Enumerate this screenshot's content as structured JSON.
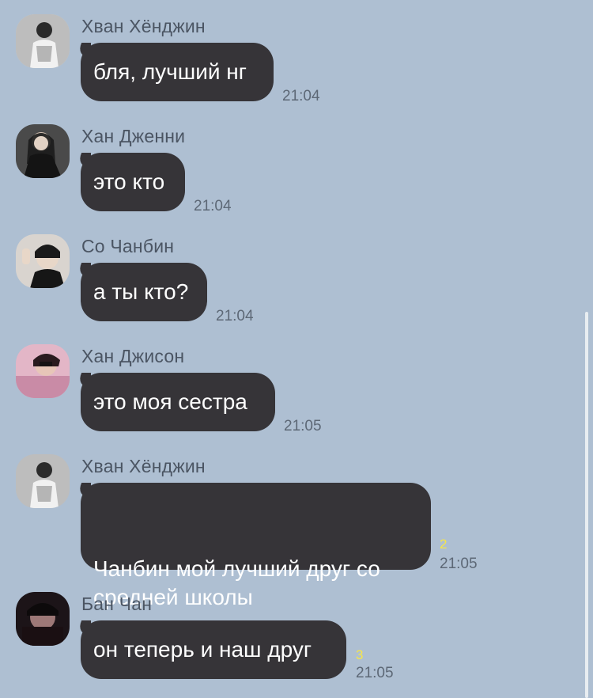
{
  "chat": {
    "messages": [
      {
        "sender": "Хван Хёнджин",
        "text": "бля, лучший нг",
        "time": "21:04",
        "unread": ""
      },
      {
        "sender": "Хан Дженни",
        "text": "это кто",
        "time": "21:04",
        "unread": ""
      },
      {
        "sender": "Со Чанбин",
        "text": "а ты кто?",
        "time": "21:04",
        "unread": ""
      },
      {
        "sender": "Хан Джисон",
        "text": "это моя сестра",
        "time": "21:05",
        "unread": ""
      },
      {
        "sender": "Хван Хёнджин",
        "text": "Чанбин мой лучший друг со\nсредней школы",
        "time": "21:05",
        "unread": "2"
      },
      {
        "sender": "Бан Чан",
        "text": "он теперь и наш друг",
        "time": "21:05",
        "unread": "3"
      }
    ]
  },
  "colors": {
    "background": "#aebfd2",
    "bubble": "#363438",
    "bubble_text": "#ffffff",
    "sender_name": "#4b5563",
    "time": "#5d6876",
    "unread_count": "#f6e64a"
  },
  "icons": {
    "avatar": "profile-photo"
  }
}
